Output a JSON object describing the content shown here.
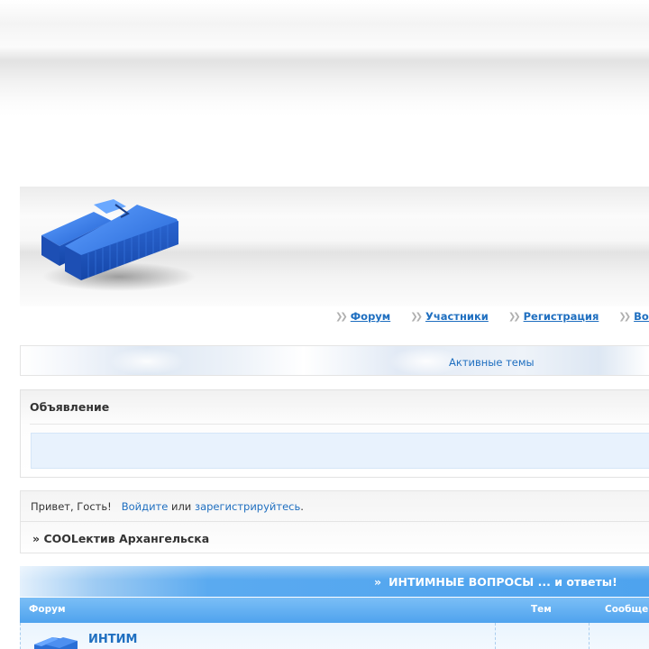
{
  "nav": {
    "items": [
      {
        "label": "Форум"
      },
      {
        "label": "Участники"
      },
      {
        "label": "Регистрация"
      },
      {
        "label": "Войти"
      }
    ]
  },
  "active_topics": {
    "label": "Активные темы"
  },
  "announcement": {
    "title": "Объявление"
  },
  "greeting": {
    "hello": "Привет, Гость!",
    "login_link": "Войдите",
    "or": "или",
    "register_link": "зарегистрируйтесь",
    "period": "."
  },
  "breadcrumb": {
    "prefix": "»",
    "title": "COOLектив Архангельска"
  },
  "category": {
    "marker": "»",
    "title": "ИНТИМНЫЕ ВОПРОСЫ ... и ответы!"
  },
  "columns": {
    "forum": "Форум",
    "topics": "Тем",
    "posts": "Сообщений"
  },
  "forum_rows": [
    {
      "name": "ИНТИМ"
    }
  ],
  "colors": {
    "accent": "#1f6fc0",
    "header_blue": "#4ea3ee",
    "logo_blue": "#2a6fd6"
  }
}
